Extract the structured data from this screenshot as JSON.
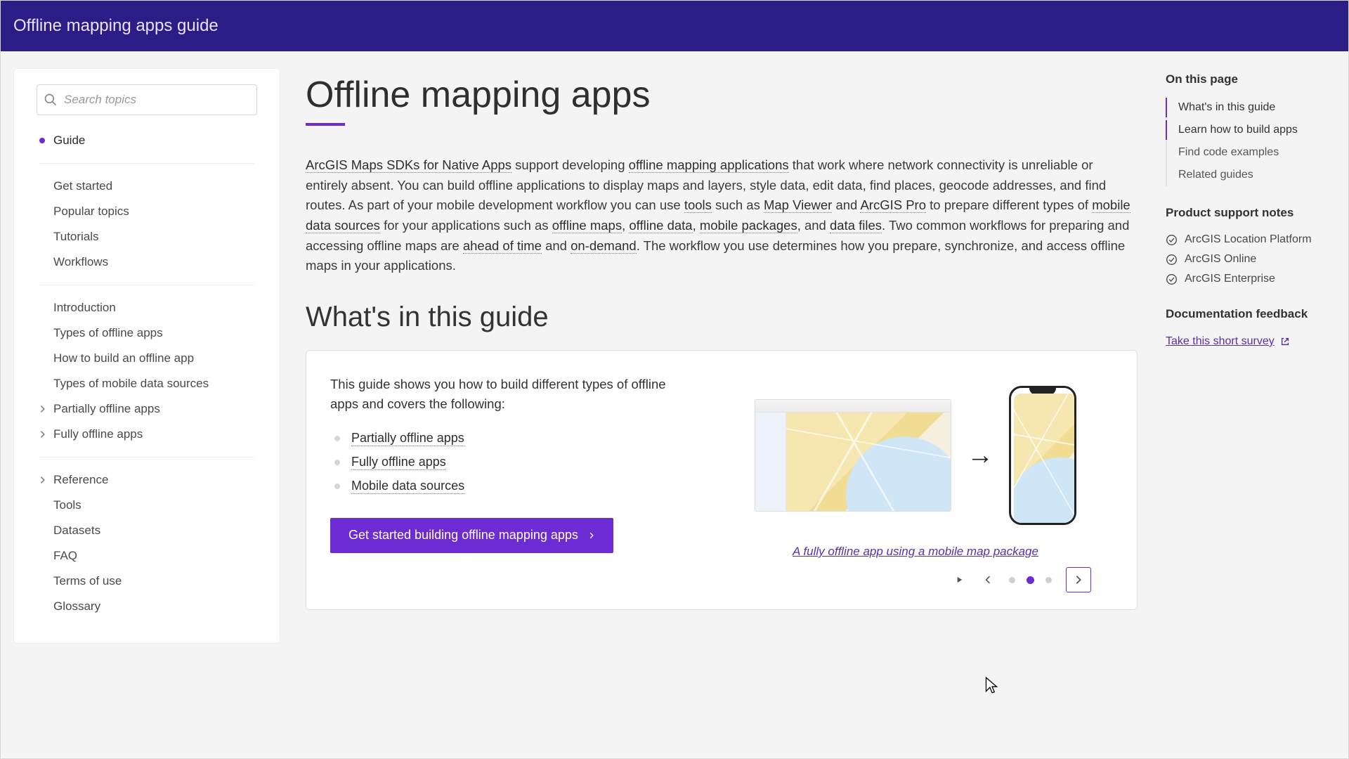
{
  "header": {
    "title": "Offline mapping apps guide"
  },
  "sidebar": {
    "search_placeholder": "Search topics",
    "groups": [
      {
        "items": [
          {
            "label": "Guide",
            "active": true
          }
        ]
      },
      {
        "items": [
          {
            "label": "Get started"
          },
          {
            "label": "Popular topics"
          },
          {
            "label": "Tutorials"
          },
          {
            "label": "Workflows"
          }
        ]
      },
      {
        "items": [
          {
            "label": "Introduction"
          },
          {
            "label": "Types of offline apps"
          },
          {
            "label": "How to build an offline app"
          },
          {
            "label": "Types of mobile data sources"
          },
          {
            "label": "Partially offline apps",
            "expandable": true
          },
          {
            "label": "Fully offline apps",
            "expandable": true
          }
        ]
      },
      {
        "items": [
          {
            "label": "Reference",
            "expandable": true
          },
          {
            "label": "Tools"
          },
          {
            "label": "Datasets"
          },
          {
            "label": "FAQ"
          },
          {
            "label": "Terms of use"
          },
          {
            "label": "Glossary"
          }
        ]
      }
    ]
  },
  "main": {
    "title": "Offline mapping apps",
    "intro_parts": [
      {
        "text": "ArcGIS Maps SDKs for Native Apps",
        "link": true
      },
      {
        "text": " support developing "
      },
      {
        "text": "offline mapping applications",
        "link": true
      },
      {
        "text": " that work where network connectivity is unreliable or entirely absent. You can build offline applications to display maps and layers, style data, edit data, find places, geocode addresses, and find routes. As part of your mobile development workflow you can use "
      },
      {
        "text": "tools",
        "link": true
      },
      {
        "text": " such as "
      },
      {
        "text": "Map Viewer",
        "link": true
      },
      {
        "text": " and "
      },
      {
        "text": "ArcGIS Pro",
        "link": true
      },
      {
        "text": " to prepare different types of "
      },
      {
        "text": "mobile data sources",
        "link": true
      },
      {
        "text": " for your applications such as "
      },
      {
        "text": "offline maps",
        "link": true
      },
      {
        "text": ", "
      },
      {
        "text": "offline data",
        "link": true
      },
      {
        "text": ", "
      },
      {
        "text": "mobile packages",
        "link": true
      },
      {
        "text": ", and "
      },
      {
        "text": "data files",
        "link": true
      },
      {
        "text": ". Two common workflows for preparing and accessing offline maps are "
      },
      {
        "text": "ahead of time",
        "link": true
      },
      {
        "text": " and "
      },
      {
        "text": "on-demand",
        "link": true
      },
      {
        "text": ". The workflow you use determines how you prepare, synchronize, and access offline maps in your applications."
      }
    ],
    "section_heading": "What's in this guide",
    "card": {
      "lead": "This guide shows you how to build different types of offline apps and covers the following:",
      "items": [
        "Partially offline apps",
        "Fully offline apps",
        "Mobile data sources"
      ],
      "cta": "Get started building offline mapping apps",
      "caption": "A fully offline app using a mobile map package",
      "active_slide": 2,
      "slide_count": 3
    }
  },
  "rail": {
    "toc_title": "On this page",
    "toc": [
      {
        "label": "What's in this guide",
        "active": true
      },
      {
        "label": "Learn how to build apps",
        "active": true
      },
      {
        "label": "Find code examples"
      },
      {
        "label": "Related guides"
      }
    ],
    "support_title": "Product support notes",
    "support": [
      "ArcGIS Location Platform",
      "ArcGIS Online",
      "ArcGIS Enterprise"
    ],
    "feedback_title": "Documentation feedback",
    "feedback_link": "Take this short survey"
  }
}
